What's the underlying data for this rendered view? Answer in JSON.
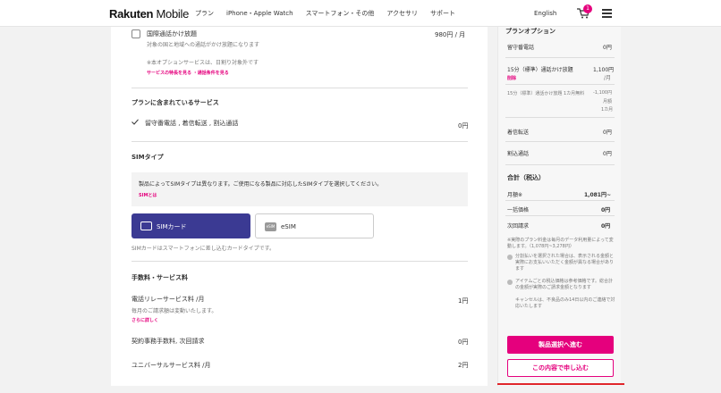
{
  "header": {
    "logo_bold": "Rakuten",
    "logo_rest": " Mobile",
    "nav": [
      "プラン",
      "iPhone・Apple Watch",
      "スマートフォン・その他",
      "アクセサリ",
      "サポート"
    ],
    "language": "English",
    "cart_count": "1"
  },
  "main": {
    "intl_call": {
      "title": "国際通話かけ放題",
      "desc": "対象の国と地域への通話がかけ放題になります",
      "price": "980円 / 月",
      "note": "※本オプションサービスは、日割り対象外です",
      "links": "サービスの特長を見る ・通話条件を見る"
    },
    "included": {
      "heading": "プランに含まれているサービス",
      "item": "留守番電話 , 着信転送 , 割込通話",
      "price": "0円"
    },
    "sim": {
      "heading": "SIMタイプ",
      "info": "製品によってSIMタイプは異なります。ご使用になる製品に対応したSIMタイプを選択してください。",
      "info_link": "SIMとは",
      "option_sim": "SIMカード",
      "option_esim": "eSIM",
      "esim_icon_text": "eSIM",
      "desc": "SIMカードはスマートフォンに差し込むカードタイプです。"
    },
    "fees": {
      "heading": "手数料・サービス料",
      "relay_title": "電話リレーサービス料 /月",
      "relay_desc": "毎月のご請求額は変動いたします。",
      "relay_link": "さらに詳しく",
      "relay_price": "1円",
      "contract_title": "契約事務手数料, 次回請求",
      "contract_price": "0円",
      "universal_title": "ユニバーサルサービス料 /月",
      "universal_price": "2円"
    }
  },
  "side": {
    "heading": "プランオプション",
    "voicemail_label": "留守番電話",
    "voicemail_price": "0円",
    "call15_label": "15分（標準）通話かけ放題",
    "call15_price": "1,100円",
    "call15_unit": "/月",
    "delete": "削除",
    "call15_discount_label": "15分（標準）通話かけ放題 1カ月無料",
    "call15_discount_price": "-1,100円",
    "call15_discount_unit1": "月額",
    "call15_discount_unit2": "1カ月",
    "forward_label": "着信転送",
    "forward_price": "0円",
    "interrupt_label": "割込通話",
    "interrupt_price": "0円",
    "total_heading": "合計（税込）",
    "monthly_label": "月額※",
    "monthly_price": "1,081円~",
    "lump_label": "一括価格",
    "lump_price": "0円",
    "next_label": "次回請求",
    "next_price": "0円",
    "note1": "※実際のプラン料金は毎月のデータ利用量によって変動します。（1,078円~3,278円）",
    "note2": "分割払いを選択された場合は、表示される金額と実際にお支払いいただく金額が異なる場合があります",
    "note3": "アイテムごとの税込価格は参考価格です。総合計の金額が実際のご請求金額となります",
    "note4": "キャンセルは、不良品のみ14日以内のご連絡で対応いたします",
    "cta_primary": "製品選択へ進む",
    "cta_secondary": "この内容で申し込む"
  }
}
